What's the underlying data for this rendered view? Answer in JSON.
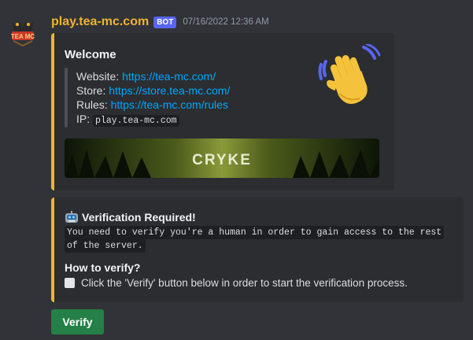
{
  "message": {
    "username": "play.tea-mc.com",
    "badge": "BOT",
    "timestamp": "07/16/2022 12:36 AM",
    "avatar_icon": "tea-mc-logo-icon",
    "avatar_text": "TEA MC"
  },
  "embed_welcome": {
    "title": "Welcome",
    "website_label": "Website: ",
    "website_url": "https://tea-mc.com/",
    "store_label": "Store: ",
    "store_url": "https://store.tea-mc.com/",
    "rules_label": "Rules: ",
    "rules_url": "https://tea-mc.com/rules",
    "ip_label": "IP: ",
    "ip_value": "play.tea-mc.com",
    "thumbnail_icon": "waving-hand-icon",
    "banner_text": "CRYKE",
    "accent_color": "#f0b232"
  },
  "embed_verify": {
    "title": "Verification Required!",
    "title_icon": "robot-icon",
    "code_text": "You need to verify you're a human in order to gain access to the rest of the server.",
    "howto_title": "How to verify?",
    "instruction": "Click the 'Verify' button below in order to start the verification process.",
    "instruction_icon": "checkbox-icon"
  },
  "button": {
    "verify_label": "Verify",
    "color": "#248046"
  }
}
